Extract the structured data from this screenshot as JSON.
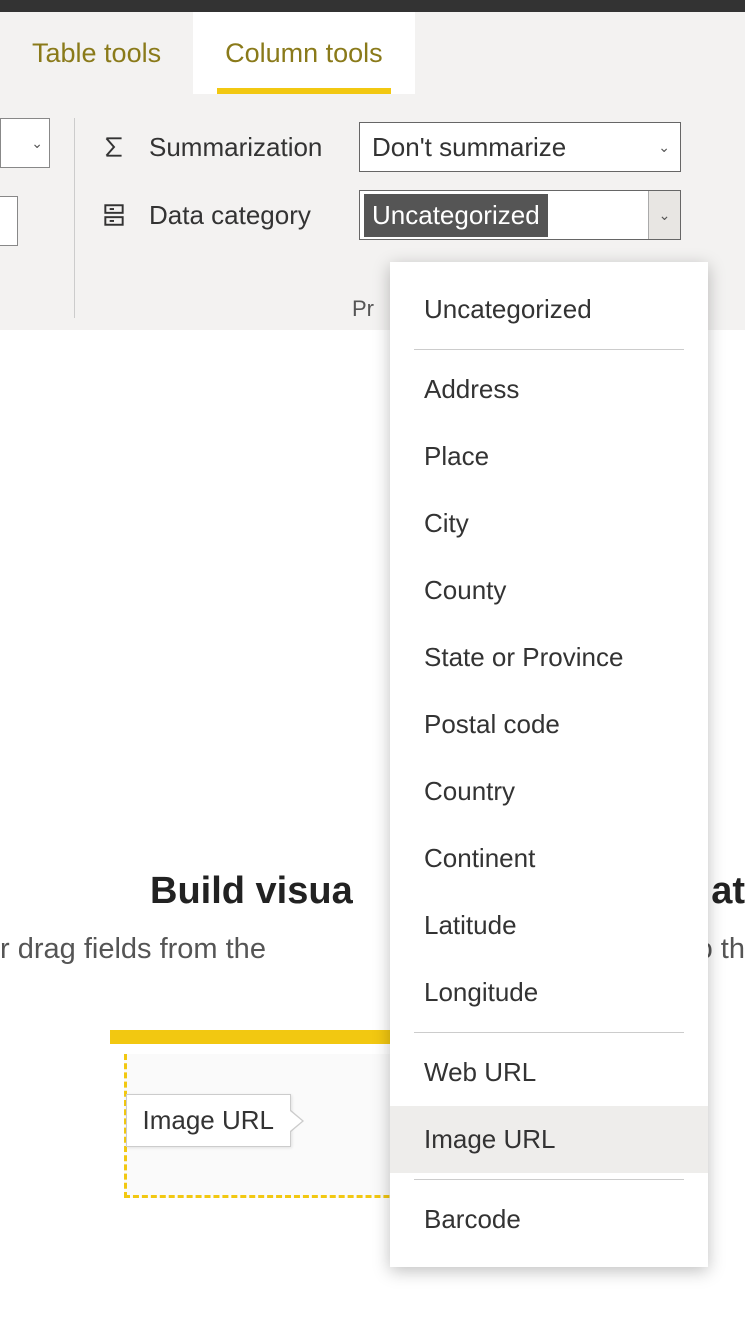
{
  "tabs": {
    "table_tools": "Table tools",
    "column_tools": "Column tools"
  },
  "ribbon": {
    "summarization_label": "Summarization",
    "summarization_value": "Don't summarize",
    "data_category_label": "Data category",
    "data_category_value": "Uncategorized",
    "group_label_partial": "Pr"
  },
  "dropdown": {
    "items": [
      "Uncategorized",
      "Address",
      "Place",
      "City",
      "County",
      "State or Province",
      "Postal code",
      "Country",
      "Continent",
      "Latitude",
      "Longitude",
      "Web URL",
      "Image URL",
      "Barcode"
    ],
    "hovered_index": 12,
    "separators_after": [
      0,
      10,
      12
    ]
  },
  "canvas": {
    "title_partial": "Build visua",
    "title_right_partial": "at",
    "subtitle_left_partial": "r drag fields from the",
    "subtitle_right_partial": "o th",
    "drag_tooltip": "Image URL"
  }
}
